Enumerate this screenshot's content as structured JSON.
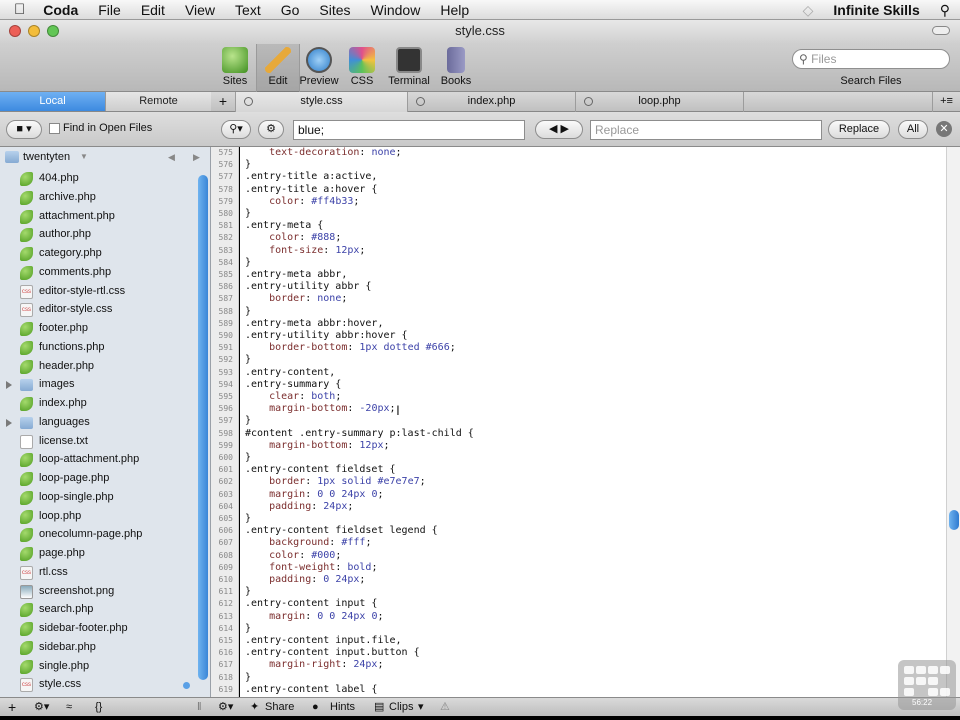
{
  "menubar": {
    "app": "Coda",
    "items": [
      "File",
      "Edit",
      "View",
      "Text",
      "Go",
      "Sites",
      "Window",
      "Help"
    ],
    "right_label": "Infinite Skills"
  },
  "window": {
    "title": "style.css"
  },
  "toolbar": {
    "buttons": [
      {
        "label": "Sites",
        "icon": "sites-icon",
        "color": "#4aa43a"
      },
      {
        "label": "Edit",
        "icon": "edit-pencil-icon",
        "color": "#e3b24a"
      },
      {
        "label": "Preview",
        "icon": "preview-magnifier-icon",
        "color": "#3b8fd8"
      },
      {
        "label": "CSS",
        "icon": "css-icon",
        "color": "#d84a8a"
      },
      {
        "label": "Terminal",
        "icon": "terminal-icon",
        "color": "#3a3a3a"
      },
      {
        "label": "Books",
        "icon": "books-icon",
        "color": "#6a6a9a"
      }
    ],
    "search_placeholder": "Files",
    "search_label": "Search Files"
  },
  "sidebar_tabs": {
    "local": "Local",
    "remote": "Remote"
  },
  "editor_tabs": [
    "style.css",
    "index.php",
    "loop.php"
  ],
  "findbar": {
    "find_in_open_files": "Find in Open Files",
    "search_value": "blue;",
    "replace_placeholder": "Replace",
    "replace_button": "Replace",
    "all_button": "All"
  },
  "sidebar": {
    "root": "twentyten",
    "files": [
      {
        "name": "404.php",
        "type": "php"
      },
      {
        "name": "archive.php",
        "type": "php"
      },
      {
        "name": "attachment.php",
        "type": "php"
      },
      {
        "name": "author.php",
        "type": "php"
      },
      {
        "name": "category.php",
        "type": "php"
      },
      {
        "name": "comments.php",
        "type": "php"
      },
      {
        "name": "editor-style-rtl.css",
        "type": "css"
      },
      {
        "name": "editor-style.css",
        "type": "css"
      },
      {
        "name": "footer.php",
        "type": "php"
      },
      {
        "name": "functions.php",
        "type": "php"
      },
      {
        "name": "header.php",
        "type": "php"
      },
      {
        "name": "images",
        "type": "folder"
      },
      {
        "name": "index.php",
        "type": "php"
      },
      {
        "name": "languages",
        "type": "folder"
      },
      {
        "name": "license.txt",
        "type": "txt"
      },
      {
        "name": "loop-attachment.php",
        "type": "php"
      },
      {
        "name": "loop-page.php",
        "type": "php"
      },
      {
        "name": "loop-single.php",
        "type": "php"
      },
      {
        "name": "loop.php",
        "type": "php"
      },
      {
        "name": "onecolumn-page.php",
        "type": "php"
      },
      {
        "name": "page.php",
        "type": "php"
      },
      {
        "name": "rtl.css",
        "type": "css"
      },
      {
        "name": "screenshot.png",
        "type": "png"
      },
      {
        "name": "search.php",
        "type": "php"
      },
      {
        "name": "sidebar-footer.php",
        "type": "php"
      },
      {
        "name": "sidebar.php",
        "type": "php"
      },
      {
        "name": "single.php",
        "type": "php"
      },
      {
        "name": "style.css",
        "type": "css"
      }
    ]
  },
  "code": [
    {
      "n": "575",
      "t": "    text-decoration: none;"
    },
    {
      "n": "576",
      "t": "}"
    },
    {
      "n": "577",
      "t": ".entry-title a:active,"
    },
    {
      "n": "578",
      "t": ".entry-title a:hover {"
    },
    {
      "n": "579",
      "t": "    color: #ff4b33;"
    },
    {
      "n": "580",
      "t": "}"
    },
    {
      "n": "581",
      "t": ".entry-meta {"
    },
    {
      "n": "582",
      "t": "    color: #888;"
    },
    {
      "n": "583",
      "t": "    font-size: 12px;"
    },
    {
      "n": "584",
      "t": "}"
    },
    {
      "n": "585",
      "t": ".entry-meta abbr,"
    },
    {
      "n": "586",
      "t": ".entry-utility abbr {"
    },
    {
      "n": "587",
      "t": "    border: none;"
    },
    {
      "n": "588",
      "t": "}"
    },
    {
      "n": "589",
      "t": ".entry-meta abbr:hover,"
    },
    {
      "n": "590",
      "t": ".entry-utility abbr:hover {"
    },
    {
      "n": "591",
      "t": "    border-bottom: 1px dotted #666;"
    },
    {
      "n": "592",
      "t": "}"
    },
    {
      "n": "593",
      "t": ".entry-content,"
    },
    {
      "n": "594",
      "t": ".entry-summary {"
    },
    {
      "n": "595",
      "t": "    clear: both;"
    },
    {
      "n": "596",
      "t": "    margin-bottom: -20px;"
    },
    {
      "n": "597",
      "t": "}"
    },
    {
      "n": "598",
      "t": "#content .entry-summary p:last-child {"
    },
    {
      "n": "599",
      "t": "    margin-bottom: 12px;"
    },
    {
      "n": "600",
      "t": "}"
    },
    {
      "n": "601",
      "t": ".entry-content fieldset {"
    },
    {
      "n": "602",
      "t": "    border: 1px solid #e7e7e7;"
    },
    {
      "n": "603",
      "t": "    margin: 0 0 24px 0;"
    },
    {
      "n": "604",
      "t": "    padding: 24px;"
    },
    {
      "n": "605",
      "t": "}"
    },
    {
      "n": "606",
      "t": ".entry-content fieldset legend {"
    },
    {
      "n": "607",
      "t": "    background: #fff;"
    },
    {
      "n": "608",
      "t": "    color: #000;"
    },
    {
      "n": "609",
      "t": "    font-weight: bold;"
    },
    {
      "n": "610",
      "t": "    padding: 0 24px;"
    },
    {
      "n": "611",
      "t": "}"
    },
    {
      "n": "612",
      "t": ".entry-content input {"
    },
    {
      "n": "613",
      "t": "    margin: 0 0 24px 0;"
    },
    {
      "n": "614",
      "t": "}"
    },
    {
      "n": "615",
      "t": ".entry-content input.file,"
    },
    {
      "n": "616",
      "t": ".entry-content input.button {"
    },
    {
      "n": "617",
      "t": "    margin-right: 24px;"
    },
    {
      "n": "618",
      "t": "}"
    },
    {
      "n": "619",
      "t": ".entry-content label {"
    }
  ],
  "bottombar": {
    "share": "Share",
    "hints": "Hints",
    "clips": "Clips"
  },
  "watermark_time": "56:22"
}
